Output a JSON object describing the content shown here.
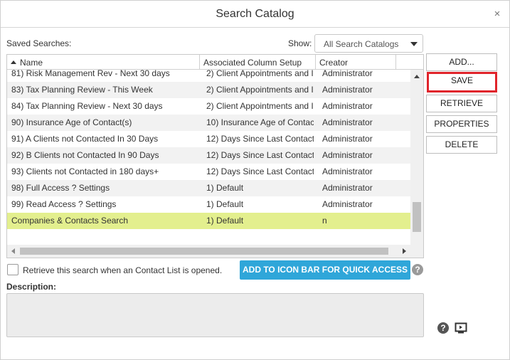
{
  "dialog": {
    "title": "Search Catalog",
    "close_glyph": "×"
  },
  "saved_searches": {
    "label": "Saved Searches:",
    "show_label": "Show:",
    "show_selected": "All Search Catalogs"
  },
  "grid": {
    "columns": [
      "Name",
      "Associated Column Setup",
      "Creator"
    ],
    "sort_column": "Name",
    "sort_direction": "ascending",
    "rows": [
      {
        "name": "81) Risk Management Rev - Next 30 days",
        "setup": "2) Client Appointments and I",
        "creator": "Administrator"
      },
      {
        "name": "83) Tax Planning Review - This Week",
        "setup": "2) Client Appointments and I",
        "creator": "Administrator"
      },
      {
        "name": "84) Tax Planning Review - Next 30 days",
        "setup": "2) Client Appointments and I",
        "creator": "Administrator"
      },
      {
        "name": "90) Insurance Age of Contact(s)",
        "setup": "10) Insurance Age of Contac",
        "creator": "Administrator"
      },
      {
        "name": "91) A Clients not Contacted In 30 Days",
        "setup": "12) Days Since Last Contact",
        "creator": "Administrator"
      },
      {
        "name": "92) B Clients not Contacted In 90 Days",
        "setup": "12) Days Since Last Contact",
        "creator": "Administrator"
      },
      {
        "name": "93) Clients not Contacted in 180 days+",
        "setup": "12) Days Since Last Contact",
        "creator": "Administrator"
      },
      {
        "name": "98) Full Access ? Settings",
        "setup": "1) Default",
        "creator": "Administrator"
      },
      {
        "name": "99) Read Access ? Settings",
        "setup": "1) Default",
        "creator": "Administrator"
      },
      {
        "name": "Companies & Contacts Search",
        "setup": "1) Default",
        "creator": "n"
      }
    ],
    "selected_row": 9
  },
  "actions": {
    "add": "ADD...",
    "save": "SAVE",
    "retrieve": "RETRIEVE",
    "properties": "PROPERTIES",
    "delete": "DELETE"
  },
  "options": {
    "retrieve_on_open_label": "Retrieve this search when an Contact List is opened.",
    "retrieve_on_open_checked": false,
    "quick_access_button": "ADD TO ICON BAR FOR QUICK ACCESS"
  },
  "description": {
    "label": "Description:",
    "value": ""
  },
  "icons": {
    "help": "help-icon",
    "video": "video-icon",
    "close": "close-icon"
  },
  "colors": {
    "quick_access_bg": "#2fa6d9",
    "highlight_border": "#e0242b",
    "selected_row_bg": "#e3ef8e",
    "help_icon_gray": "#9a9a9a",
    "help_icon_dark": "#555555"
  }
}
